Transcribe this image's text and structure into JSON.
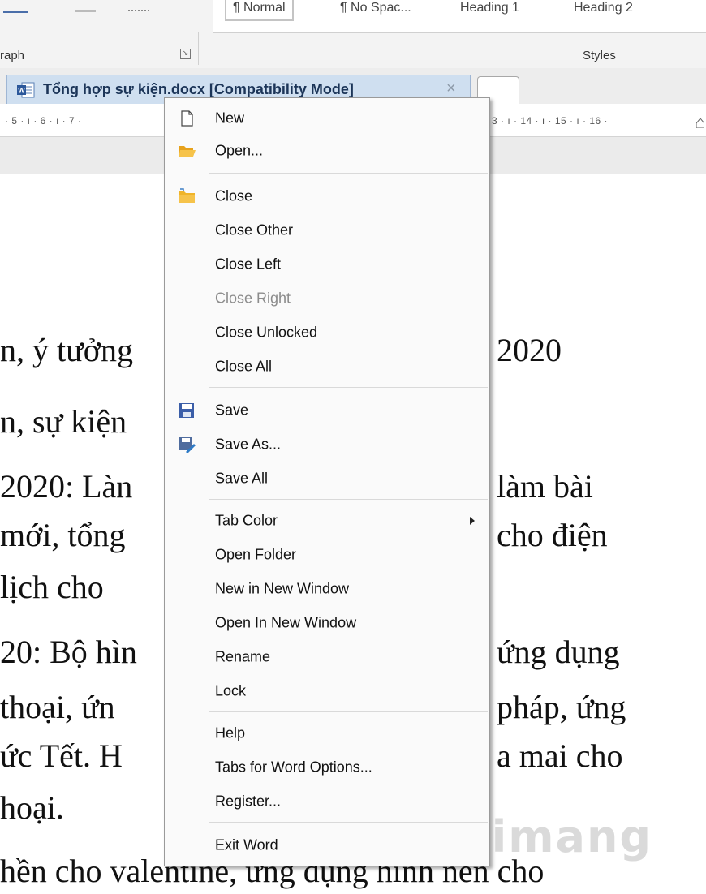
{
  "ribbon": {
    "styles": [
      {
        "label": "¶ Normal",
        "selected": true
      },
      {
        "label": "¶ No Spac...",
        "selected": false
      },
      {
        "label": "Heading 1",
        "selected": false
      },
      {
        "label": "Heading 2",
        "selected": false
      }
    ],
    "paragraph_group_label": "raph",
    "styles_group_label": "Styles"
  },
  "tab": {
    "title": "Tổng hợp sự kiện.docx [Compatibility Mode]",
    "close_glyph": "×"
  },
  "ruler": {
    "left_ticks": "· 5 · ı · 6 · ı · 7 ·",
    "right_ticks": "3 · ı · 14 · ı · 15 · ı · 16 ·"
  },
  "document": {
    "lines_left": [
      "n, ý tưởng",
      "n, sự kiện",
      "2020: Làn",
      " mới, tổng",
      " lịch cho",
      "20: Bộ hìn",
      " thoại, ứn",
      "ức Tết.  H",
      "hoại."
    ],
    "lines_right": [
      "2020",
      "làm bài",
      "cho điện",
      "ứng dụng",
      "pháp, ứng",
      "a mai cho"
    ],
    "bottom_line": "hền cho valentine, ứng dụng hình nền cho"
  },
  "menu": {
    "items": [
      {
        "label": "New",
        "icon": "new-document-icon",
        "disabled": false
      },
      {
        "label": "Open...",
        "icon": "open-folder-icon",
        "disabled": false
      },
      {
        "label": "Close",
        "icon": "close-folder-icon",
        "disabled": false
      },
      {
        "label": "Close Other",
        "icon": "",
        "disabled": false
      },
      {
        "label": "Close Left",
        "icon": "",
        "disabled": false
      },
      {
        "label": "Close Right",
        "icon": "",
        "disabled": true
      },
      {
        "label": "Close Unlocked",
        "icon": "",
        "disabled": false
      },
      {
        "label": "Close All",
        "icon": "",
        "disabled": false
      },
      {
        "label": "Save",
        "icon": "save-icon",
        "disabled": false
      },
      {
        "label": "Save As...",
        "icon": "save-as-icon",
        "disabled": false
      },
      {
        "label": "Save All",
        "icon": "",
        "disabled": false
      },
      {
        "label": "Tab Color",
        "icon": "",
        "disabled": false,
        "submenu": true
      },
      {
        "label": "Open Folder",
        "icon": "",
        "disabled": false
      },
      {
        "label": "New in New Window",
        "icon": "",
        "disabled": false
      },
      {
        "label": "Open In New Window",
        "icon": "",
        "disabled": false
      },
      {
        "label": "Rename",
        "icon": "",
        "disabled": false
      },
      {
        "label": "Lock",
        "icon": "",
        "disabled": false
      },
      {
        "label": "Help",
        "icon": "",
        "disabled": false
      },
      {
        "label": "Tabs for Word Options...",
        "icon": "",
        "disabled": false
      },
      {
        "label": "Register...",
        "icon": "",
        "disabled": false
      },
      {
        "label": "Exit Word",
        "icon": "",
        "disabled": false
      }
    ]
  },
  "watermark": "uantrimang",
  "colors": {
    "tab_bg": "#cfdff0",
    "tab_text": "#1c3558",
    "menu_bg": "#fafafa",
    "disabled_text": "#8c8c8c",
    "folder": "#f0b429",
    "save_icon": "#3b5ea8"
  }
}
